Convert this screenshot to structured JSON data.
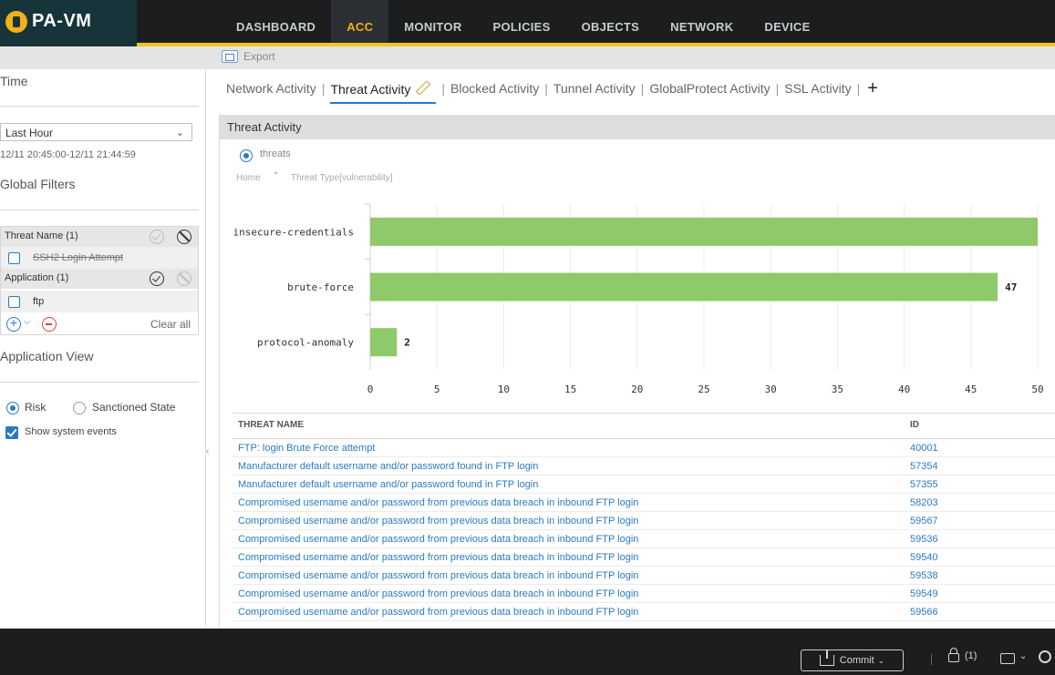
{
  "app": {
    "logo_text": "PA-VM",
    "brand_color": "#f2b019",
    "nav": [
      {
        "label": "DASHBOARD"
      },
      {
        "label": "ACC",
        "active": true
      },
      {
        "label": "MONITOR"
      },
      {
        "label": "POLICIES"
      },
      {
        "label": "OBJECTS"
      },
      {
        "label": "NETWORK"
      },
      {
        "label": "DEVICE"
      }
    ]
  },
  "toolbar": {
    "export_label": "Export",
    "export_icon": "export-icon"
  },
  "left_panel": {
    "time_heading": "Time",
    "time_select_value": "Last Hour",
    "time_range": "12/11 20:45:00-12/11 21:44:59",
    "global_filters_heading": "Global Filters",
    "filters": [
      {
        "head": "Threat Name (1)",
        "item": "SSH2 Login Attempt",
        "item_struck": true
      },
      {
        "head": "Application (1)",
        "item": "ftp",
        "item_struck": false
      }
    ],
    "clear_all_label": "Clear all",
    "application_view_heading": "Application View",
    "view_options": [
      {
        "label": "Risk",
        "selected": true
      },
      {
        "label": "Sanctioned State",
        "selected": false
      }
    ],
    "show_system_events_label": "Show system events",
    "show_system_events_checked": true
  },
  "tabs": {
    "items": [
      {
        "label": "Network Activity"
      },
      {
        "label": "Threat Activity",
        "active": true
      },
      {
        "label": "Blocked Activity"
      },
      {
        "label": "Tunnel Activity"
      },
      {
        "label": "GlobalProtect Activity"
      },
      {
        "label": "SSL Activity"
      }
    ],
    "separator": "|"
  },
  "widget": {
    "title": "Threat Activity",
    "radio_label": "threats",
    "breadcrumb": [
      "Home",
      "Threat Type[vulnerability]"
    ],
    "breadcrumb_separator": "*"
  },
  "chart_data": {
    "type": "bar",
    "orientation": "horizontal",
    "categories": [
      "insecure-credentials",
      "brute-force",
      "protocol-anomaly"
    ],
    "values": [
      51,
      47,
      2
    ],
    "data_labels": [
      "",
      "47",
      "2"
    ],
    "xlim": [
      0,
      50
    ],
    "x_ticks": [
      0,
      5,
      10,
      15,
      20,
      25,
      30,
      35,
      40,
      45,
      50
    ],
    "bar_color": "#8fca6a",
    "grid": true,
    "title": "",
    "xlabel": "",
    "ylabel": ""
  },
  "table": {
    "columns": [
      "THREAT NAME",
      "ID"
    ],
    "rows": [
      {
        "name": "FTP: login Brute Force attempt",
        "id": "40001"
      },
      {
        "name": "Manufacturer default username and/or password found in FTP login",
        "id": "57354"
      },
      {
        "name": "Manufacturer default username and/or password found in FTP login",
        "id": "57355"
      },
      {
        "name": "Compromised username and/or password from previous data breach in inbound FTP login",
        "id": "58203"
      },
      {
        "name": "Compromised username and/or password from previous data breach in inbound FTP login",
        "id": "59567"
      },
      {
        "name": "Compromised username and/or password from previous data breach in inbound FTP login",
        "id": "59536"
      },
      {
        "name": "Compromised username and/or password from previous data breach in inbound FTP login",
        "id": "59540"
      },
      {
        "name": "Compromised username and/or password from previous data breach in inbound FTP login",
        "id": "59538"
      },
      {
        "name": "Compromised username and/or password from previous data breach in inbound FTP login",
        "id": "59549"
      },
      {
        "name": "Compromised username and/or password from previous data breach in inbound FTP login",
        "id": "59566"
      }
    ],
    "link_color": "#2a7ac2"
  },
  "bottom_bar": {
    "commit_label": "Commit",
    "lock_count": "(1)"
  }
}
